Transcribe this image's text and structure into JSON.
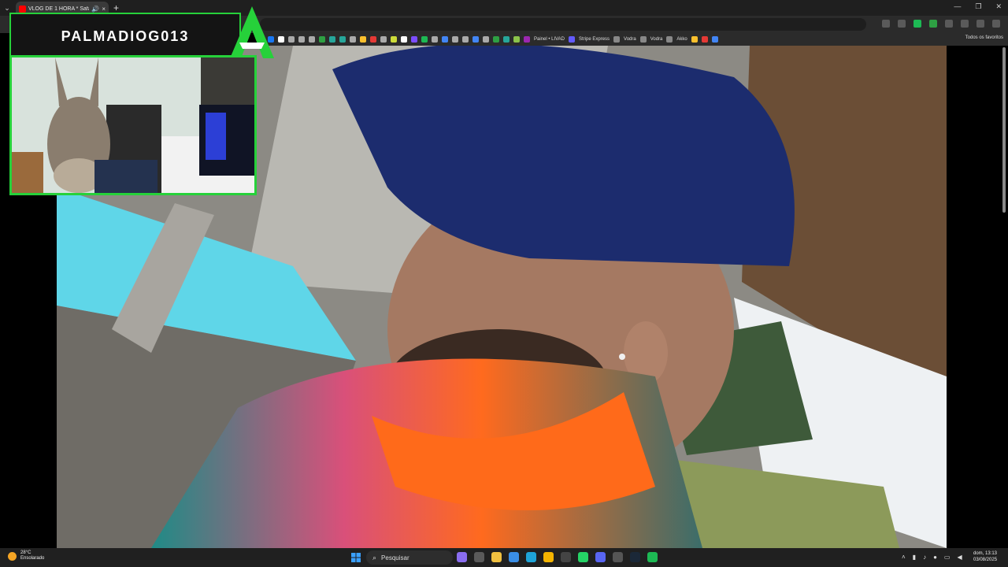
{
  "browser": {
    "tab_title": "VLOG DE 1 HORA * Safari...",
    "new_tab_icon": "plus-icon",
    "bookmarks": [
      {
        "label": "Painel • LIVAD",
        "color": "#9c27b0"
      },
      {
        "label": "Stripe Express",
        "color": "#635bff"
      },
      {
        "label": "Vodra",
        "color": "#888888"
      },
      {
        "label": "Vodra",
        "color": "#888888"
      },
      {
        "label": "Akko",
        "color": "#888888"
      }
    ],
    "all_bookmarks_label": "Todos os favoritos"
  },
  "overlay": {
    "streamer_name": "PALMADIOG013",
    "accent_color": "#26d13a"
  },
  "taskbar": {
    "weather_temp": "28°C",
    "weather_desc": "Ensolarado",
    "search_placeholder": "Pesquisar",
    "clock_time": "dom, 13:13",
    "clock_date": "03/08/2025"
  }
}
